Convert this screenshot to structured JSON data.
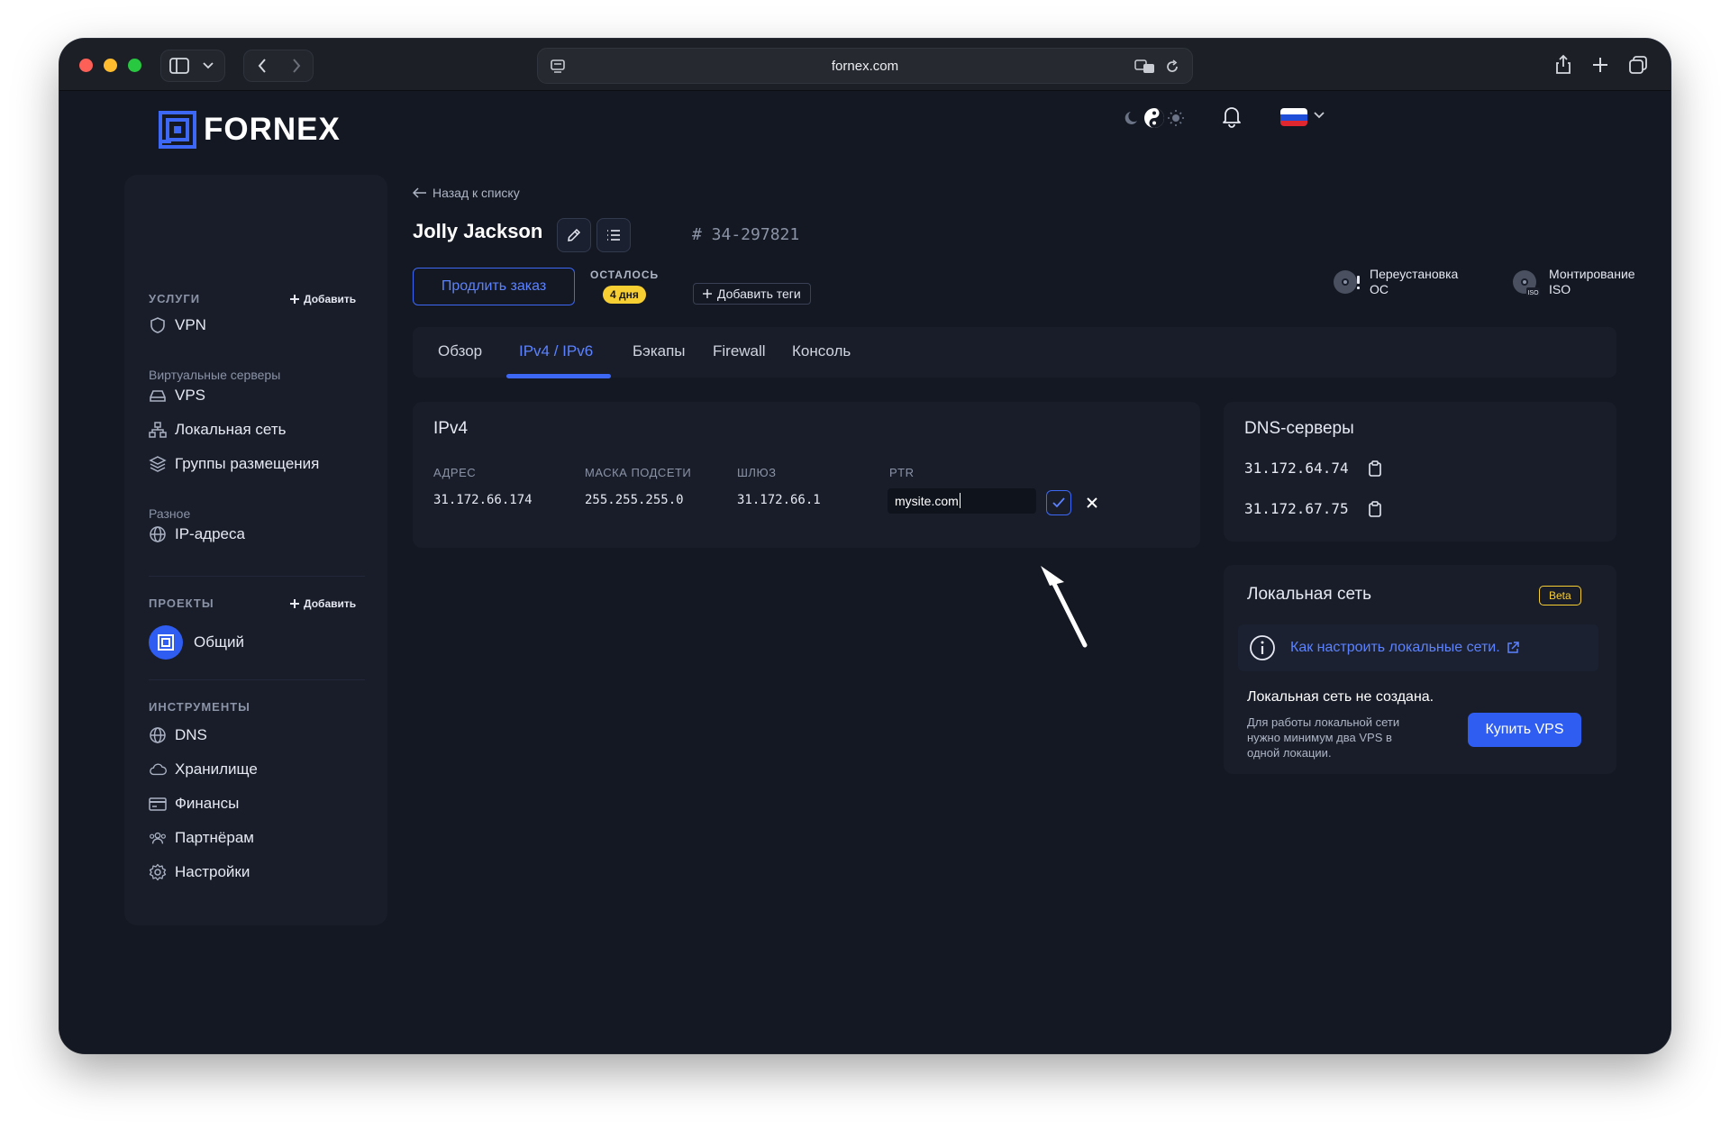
{
  "browser": {
    "url": "fornex.com"
  },
  "header": {
    "logo_text": "FORNEX",
    "language_flag": "ru-flag-icon"
  },
  "sidebar": {
    "services_title": "УСЛУГИ",
    "services_add": "Добавить",
    "vpn": "VPN",
    "virtual_servers_title": "Виртуальные серверы",
    "vps": "VPS",
    "local_network": "Локальная сеть",
    "placement_groups": "Группы размещения",
    "misc_title": "Разное",
    "ip_addresses": "IP-адреса",
    "projects_title": "ПРОЕКТЫ",
    "projects_add": "Добавить",
    "project_common": "Общий",
    "tools_title": "ИНСТРУМЕНТЫ",
    "dns": "DNS",
    "storage": "Хранилище",
    "finances": "Финансы",
    "partners": "Партнёрам",
    "settings": "Настройки"
  },
  "server": {
    "back_link": "Назад к списку",
    "name": "Jolly Jackson",
    "order_number": "# 34-297821",
    "renew_button": "Продлить заказ",
    "remaining_label": "ОСТАЛОСЬ",
    "remaining_value": "4 дня",
    "add_tags": "Добавить теги",
    "reinstall_os": [
      "Переустановка",
      "ОС"
    ],
    "mount_iso": [
      "Монтирование",
      "ISO"
    ],
    "iso_label": "ISO"
  },
  "tabs": [
    {
      "label": "Обзор",
      "active": false
    },
    {
      "label": "IPv4 / IPv6",
      "active": true
    },
    {
      "label": "Бэкапы",
      "active": false
    },
    {
      "label": "Firewall",
      "active": false
    },
    {
      "label": "Консоль",
      "active": false
    }
  ],
  "ipv4": {
    "title": "IPv4",
    "columns": [
      "АДРЕС",
      "МАСКА ПОДСЕТИ",
      "ШЛЮЗ",
      "PTR"
    ],
    "row": {
      "address": "31.172.66.174",
      "mask": "255.255.255.0",
      "gateway": "31.172.66.1",
      "ptr": "mysite.com"
    }
  },
  "dns_servers": {
    "title": "DNS-серверы",
    "items": [
      "31.172.64.74",
      "31.172.67.75"
    ]
  },
  "local_net": {
    "title": "Локальная сеть",
    "badge": "Beta",
    "help_link": "Как настроить локальные сети.",
    "status": "Локальная сеть не создана.",
    "description": "Для работы локальной сети нужно минимум два VPS в одной локации.",
    "buy_button": "Купить VPS"
  },
  "colors": {
    "accent": "#3d67f5",
    "background": "#141822",
    "card": "#181d29",
    "badge_yellow": "#f8cf32"
  }
}
